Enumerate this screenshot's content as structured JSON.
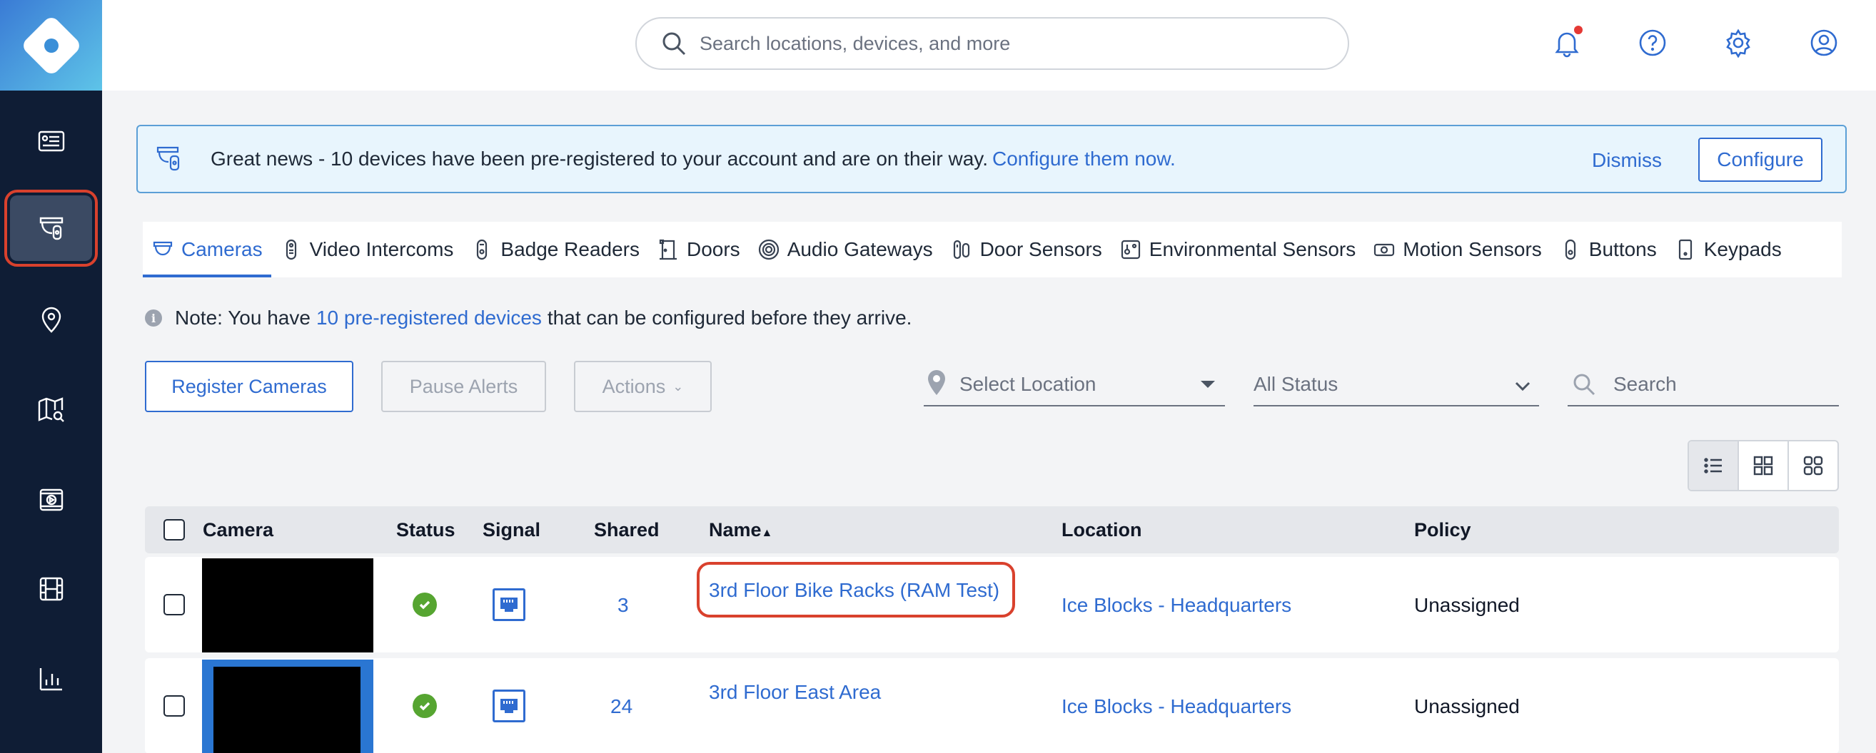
{
  "topbar": {
    "search_placeholder": "Search locations, devices, and more",
    "accent": "#2f6bd0"
  },
  "banner": {
    "message": "Great news - 10 devices have been pre-registered to your account and are on their way.",
    "link": "Configure them now.",
    "dismiss": "Dismiss",
    "configure": "Configure"
  },
  "tabs": [
    {
      "label": "Cameras",
      "icon": "camera-icon",
      "active": true
    },
    {
      "label": "Video Intercoms",
      "icon": "intercom-icon"
    },
    {
      "label": "Badge Readers",
      "icon": "badge-reader-icon"
    },
    {
      "label": "Doors",
      "icon": "door-icon"
    },
    {
      "label": "Audio Gateways",
      "icon": "audio-gateway-icon"
    },
    {
      "label": "Door Sensors",
      "icon": "door-sensor-icon"
    },
    {
      "label": "Environmental Sensors",
      "icon": "environmental-sensor-icon"
    },
    {
      "label": "Motion Sensors",
      "icon": "motion-sensor-icon"
    },
    {
      "label": "Buttons",
      "icon": "button-icon"
    },
    {
      "label": "Keypads",
      "icon": "keypad-icon"
    }
  ],
  "note": {
    "prefix": "Note: You have",
    "link": "10 pre-registered devices",
    "suffix": "that can be configured before they arrive."
  },
  "actions": {
    "register": "Register Cameras",
    "pause": "Pause Alerts",
    "actions": "Actions",
    "location_placeholder": "Select Location",
    "status_value": "All Status",
    "search_placeholder": "Search"
  },
  "table": {
    "headers": {
      "camera": "Camera",
      "status": "Status",
      "signal": "Signal",
      "shared": "Shared",
      "name": "Name",
      "sort_indicator": "▲",
      "location": "Location",
      "policy": "Policy"
    },
    "rows": [
      {
        "shared": "3",
        "name": "3rd Floor Bike Racks (RAM Test)",
        "location": "Ice Blocks - Headquarters",
        "policy": "Unassigned",
        "status": "online"
      },
      {
        "shared": "24",
        "name": "3rd Floor East Area",
        "location": "Ice Blocks - Headquarters",
        "policy": "Unassigned",
        "status": "online"
      }
    ]
  },
  "colors": {
    "sidebar": "#0f1d35",
    "highlight": "#d9412d",
    "status_ok": "#56a531"
  }
}
